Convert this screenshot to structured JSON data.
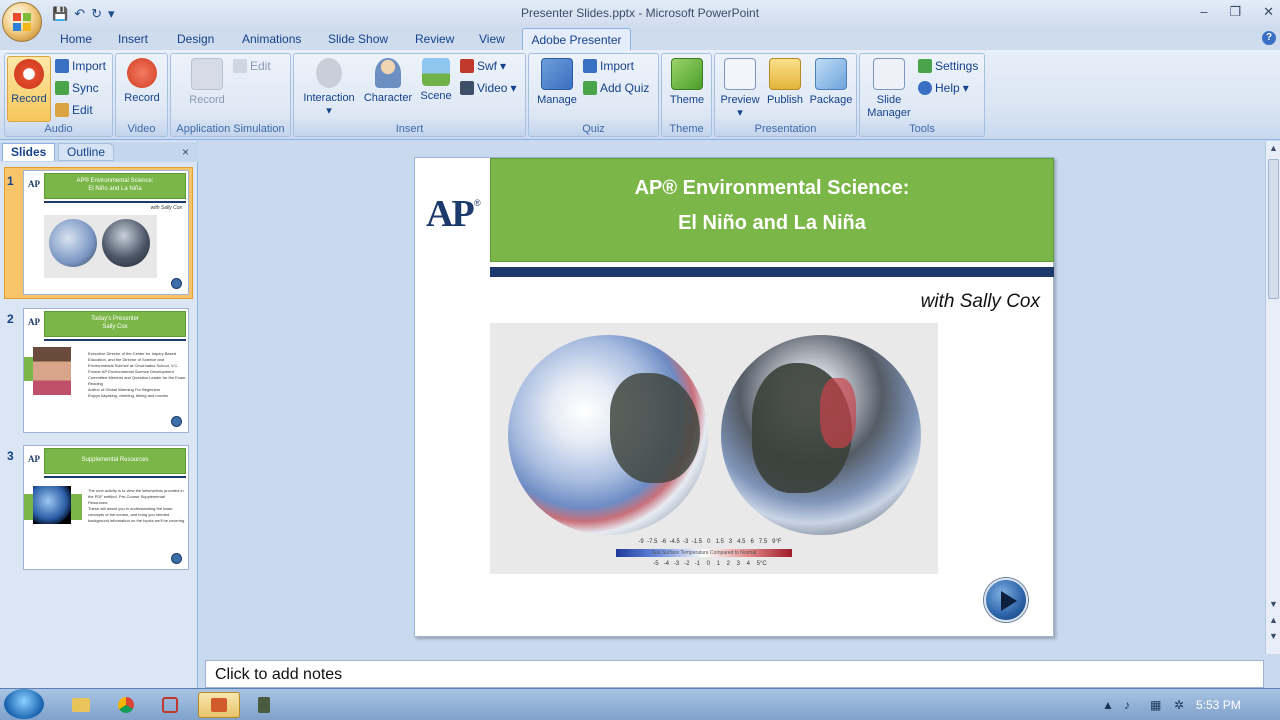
{
  "window": {
    "title": "Presenter Slides.pptx - Microsoft PowerPoint"
  },
  "window_controls": {
    "minimize": "–",
    "restore": "❐",
    "close": "✕"
  },
  "qat": {
    "save": "💾",
    "undo": "↶",
    "redo": "↻"
  },
  "tabs": [
    "Home",
    "Insert",
    "Design",
    "Animations",
    "Slide Show",
    "Review",
    "View"
  ],
  "active_tab": "Adobe Presenter",
  "ribbon": {
    "audio": {
      "label": "Audio",
      "record": "Record",
      "import": "Import",
      "sync": "Sync",
      "edit": "Edit"
    },
    "video": {
      "label": "Video",
      "record": "Record"
    },
    "appsim": {
      "label": "Application Simulation",
      "record": "Record",
      "edit": "Edit"
    },
    "insert": {
      "label": "Insert",
      "interaction": "Interaction",
      "character": "Character",
      "scene": "Scene",
      "swf": "Swf",
      "video": "Video"
    },
    "quiz": {
      "label": "Quiz",
      "manage": "Manage",
      "import": "Import",
      "add_quiz": "Add Quiz"
    },
    "theme": {
      "label": "Theme",
      "theme": "Theme"
    },
    "presentation": {
      "label": "Presentation",
      "preview": "Preview",
      "publish": "Publish",
      "package": "Package"
    },
    "tools": {
      "label": "Tools",
      "slide_manager_1": "Slide",
      "slide_manager_2": "Manager",
      "settings": "Settings",
      "help": "Help"
    }
  },
  "pane": {
    "slides_tab": "Slides",
    "outline_tab": "Outline",
    "close": "×"
  },
  "thumbs": [
    {
      "num": "1",
      "title1": "AP® Environmental Science:",
      "title2": "El Niño and La Niña",
      "sub": "with Sally Cox"
    },
    {
      "num": "2",
      "title1": "Today's Presenter",
      "title2": "Sally Cox",
      "bullets": [
        "Executive Director of the Center for Inquiry Based Education, and the Director of Science and Environmental Science at Cincinnatus School, V.C.",
        "Former AP Environmental Science Development Committee Member and Question Leader for the Exam Reading",
        "Author of Global Warming For Beginners",
        "Enjoys kayaking, climbing, biking and movies"
      ]
    },
    {
      "num": "3",
      "title1": "Supplemental Resources",
      "bullets": [
        "The next activity is to view the links/videos provided in the PDF entitled, Pre-Course Supplemental Resources.",
        "These will assist you in understanding the basic concepts of the course, and bring you needed background information on the topics we'll be covering."
      ]
    }
  ],
  "slide": {
    "ap_logo": "AP",
    "title_line1": "AP® Environmental Science:",
    "title_line2": "El Niño and La Niña",
    "subtitle": "with Sally Cox",
    "legend_top": "-9  -7.5  -6  -4.5  -3  -1.5   0   1.5   3   4.5   6   7.5   9°F",
    "legend_bottom": "-5   -4   -3   -2   -1    0    1    2    3    4    5°C",
    "legend_caption": "Sea Surface Temperature Compared to Normal"
  },
  "notes": {
    "placeholder": "Click to add notes"
  },
  "taskbar": {
    "time": "5:53 PM"
  },
  "colors": {
    "green": "#7ab648",
    "navy": "#1c3a6b",
    "ribbon": "#dbe6f4"
  }
}
